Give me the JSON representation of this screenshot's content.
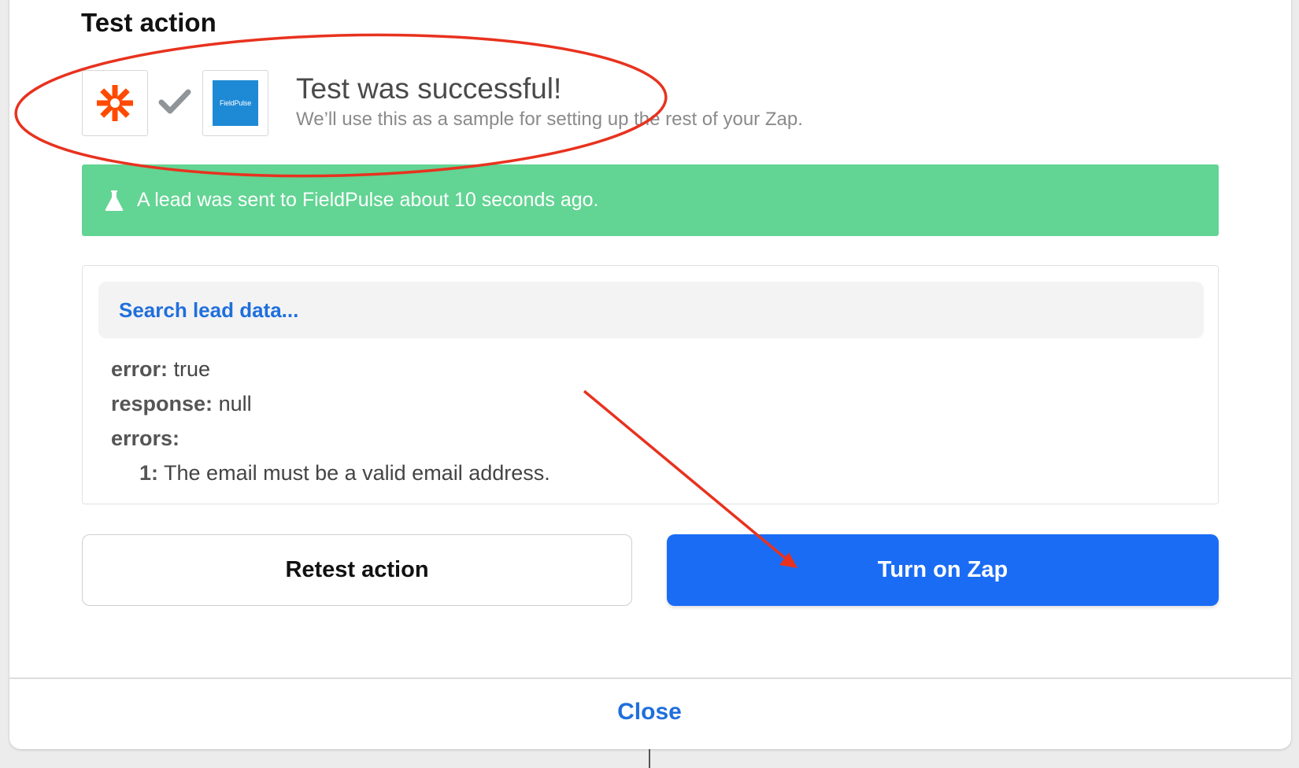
{
  "section": {
    "title": "Test action"
  },
  "apps": {
    "trigger_icon": "zapier-asterisk-icon",
    "status_icon": "checkmark-icon",
    "action_icon": "fieldpulse-logo-icon",
    "action_logo_text": "FieldPulse"
  },
  "result": {
    "title": "Test was successful!",
    "subtitle": "We’ll use this as a sample for setting up the rest of your Zap."
  },
  "banner": {
    "icon": "flask-icon",
    "text": "A lead was sent to FieldPulse about 10 seconds ago."
  },
  "lead_data": {
    "search_placeholder": "Search lead data...",
    "fields": [
      {
        "key": "error:",
        "value": "true"
      },
      {
        "key": "response:",
        "value": "null"
      },
      {
        "key": "errors:",
        "value": ""
      },
      {
        "key": "1:",
        "value": "The email must be a valid email address."
      }
    ]
  },
  "actions": {
    "retest_label": "Retest action",
    "turn_on_label": "Turn on Zap"
  },
  "footer": {
    "close_label": "Close"
  },
  "colors": {
    "primary": "#1a6cf5",
    "success_banner": "#62d493",
    "zapier_orange": "#ff4a00",
    "fieldpulse_blue": "#1e8ad6",
    "annotation_red": "#e8321f"
  }
}
